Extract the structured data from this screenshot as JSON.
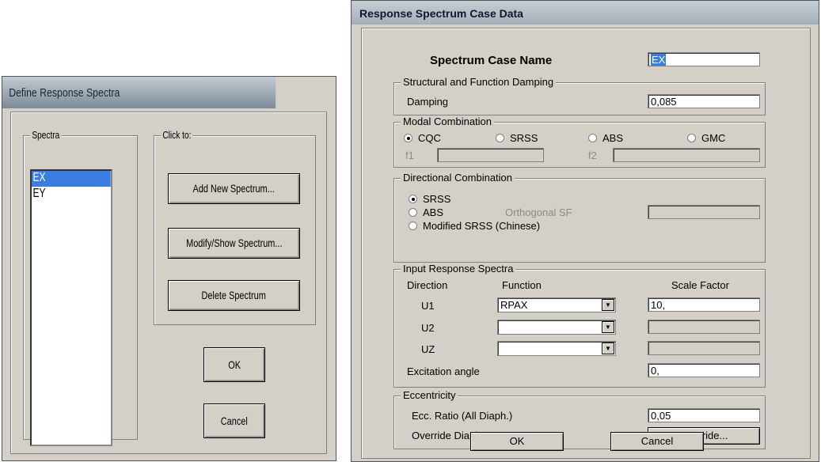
{
  "define_dialog": {
    "title": "Define Response Spectra",
    "spectra_legend": "Spectra",
    "spectra_items": [
      {
        "label": "EX",
        "selected": true
      },
      {
        "label": "EY",
        "selected": false
      }
    ],
    "click_legend": "Click to:",
    "add_label": "Add New Spectrum...",
    "modify_label": "Modify/Show Spectrum...",
    "delete_label": "Delete Spectrum",
    "ok_label": "OK",
    "cancel_label": "Cancel"
  },
  "case_dialog": {
    "title": "Response Spectrum Case Data",
    "case_name_label": "Spectrum Case Name",
    "case_name_value": "EX",
    "damping_group": "Structural and Function Damping",
    "damping_label": "Damping",
    "damping_value": "0,085",
    "modal_group": "Modal Combination",
    "modal_options": [
      "CQC",
      "SRSS",
      "ABS",
      "GMC"
    ],
    "modal_selected": "CQC",
    "f1_label": "f1",
    "f2_label": "f2",
    "f1_value": "",
    "f2_value": "",
    "directional_group": "Directional Combination",
    "dir_options": [
      "SRSS",
      "ABS",
      "Modified SRSS (Chinese)"
    ],
    "dir_selected": "SRSS",
    "orthogonal_label": "Orthogonal SF",
    "orthogonal_value": "",
    "input_group": "Input Response Spectra",
    "col_direction": "Direction",
    "col_function": "Function",
    "col_scale": "Scale Factor",
    "rows": [
      {
        "direction": "U1",
        "function": "RPAX",
        "scale": "10,"
      },
      {
        "direction": "U2",
        "function": "",
        "scale": ""
      },
      {
        "direction": "UZ",
        "function": "",
        "scale": ""
      }
    ],
    "excitation_label": "Excitation angle",
    "excitation_value": "0,",
    "eccentricity_group": "Eccentricity",
    "ecc_ratio_label": "Ecc. Ratio (All Diaph.)",
    "ecc_ratio_value": "0,05",
    "override_label": "Override Diaph. Eccen.",
    "override_button": "Override...",
    "ok_label": "OK",
    "cancel_label": "Cancel"
  },
  "colors": {
    "dialog_bg": "#d4d0c8",
    "selection": "#3b7de0"
  }
}
